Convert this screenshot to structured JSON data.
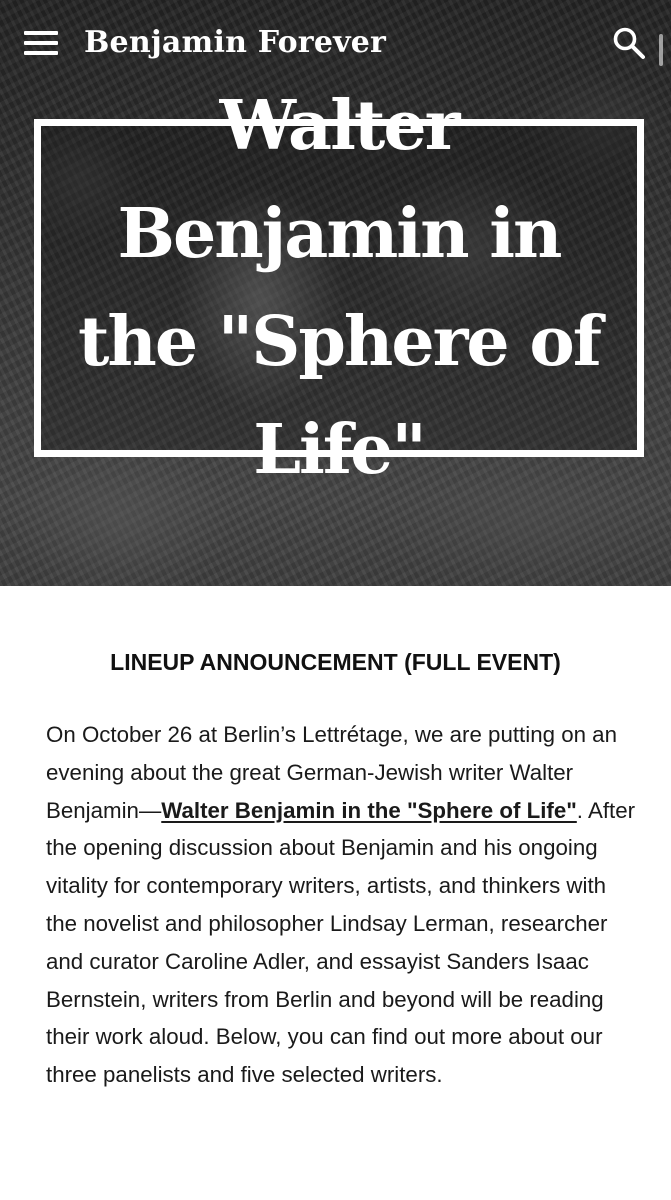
{
  "header": {
    "site_title": "Benjamin Forever",
    "menu_icon": "hamburger-menu-icon",
    "search_icon": "search-icon"
  },
  "hero": {
    "title": "Walter Benjamin in the \"Sphere of Life\""
  },
  "article": {
    "heading": "LINEUP ANNOUNCEMENT (FULL EVENT)",
    "paragraph_before_link": "On October 26 at Berlin’s Lettrétage, we are putting on an evening about the great German-Jewish writer Walter Benjamin—",
    "link_text": "Walter Benjamin in the \"Sphere of Life\"",
    "paragraph_after_link": ". After the opening discussion about Benjamin and his ongoing vitality for contemporary writers, artists, and thinkers with the novelist and philosopher Lindsay Lerman, researcher and curator Caroline Adler, and essayist Sanders Isaac Bernstein, writers from Berlin and beyond will be reading their work aloud. Below, you can find out more about our three panelists and five selected writers."
  },
  "colors": {
    "header_text": "#ffffff",
    "body_text": "#1a1a1a",
    "background": "#ffffff"
  }
}
